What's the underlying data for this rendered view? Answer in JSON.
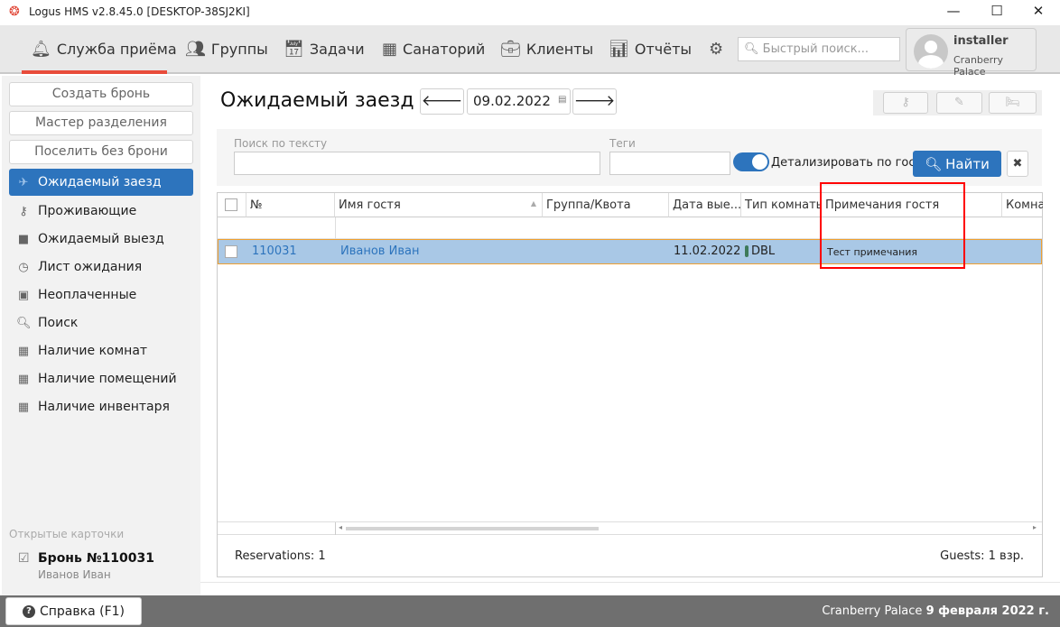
{
  "window": {
    "title": "Logus HMS v2.8.45.0 [DESKTOP-38SJ2KI]",
    "minimize": "—",
    "maximize": "☐",
    "close": "✕"
  },
  "nav": {
    "items": [
      {
        "label": "Служба приёма",
        "icon": "bell-icon"
      },
      {
        "label": "Группы",
        "icon": "users-icon"
      },
      {
        "label": "Задачи",
        "icon": "calendar-check-icon"
      },
      {
        "label": "Санаторий",
        "icon": "building-icon"
      },
      {
        "label": "Клиенты",
        "icon": "briefcase-icon"
      },
      {
        "label": "Отчёты",
        "icon": "bar-chart-icon"
      }
    ],
    "quick_search_placeholder": "Быстрый поиск...",
    "user": {
      "name": "installer",
      "hotel": "Cranberry Palace"
    }
  },
  "sidebar": {
    "buttons": [
      "Создать бронь",
      "Мастер разделения",
      "Поселить без брони"
    ],
    "items": [
      {
        "label": "Ожидаемый заезд",
        "icon": "plane-icon",
        "active": true
      },
      {
        "label": "Проживающие",
        "icon": "key-icon"
      },
      {
        "label": "Ожидаемый выезд",
        "icon": "suitcase-icon"
      },
      {
        "label": "Лист ожидания",
        "icon": "clock-icon"
      },
      {
        "label": "Неоплаченные",
        "icon": "money-icon"
      },
      {
        "label": "Поиск",
        "icon": "search-icon"
      },
      {
        "label": "Наличие комнат",
        "icon": "grid-icon"
      },
      {
        "label": "Наличие помещений",
        "icon": "grid-icon"
      },
      {
        "label": "Наличие инвентаря",
        "icon": "grid-icon"
      }
    ],
    "open_cards_label": "Открытые карточки",
    "open_card": {
      "title": "Бронь №110031",
      "subtitle": "Иванов Иван"
    }
  },
  "main": {
    "title": "Ожидаемый заезд",
    "date": "09.02.2022",
    "filter": {
      "text_label": "Поиск по тексту",
      "text_value": "",
      "tags_label": "Теги",
      "tags_value": "",
      "detail_toggle_label": "Детализировать по гостя",
      "detail_toggle_on": true,
      "find_label": "Найти"
    },
    "grid": {
      "columns": [
        "№",
        "Имя гостя",
        "Группа/Квота",
        "Дата вые...",
        "Тип комнаты",
        "Примечания гостя",
        "Комна"
      ],
      "rows": [
        {
          "number": "110031",
          "guest": "Иванов Иван",
          "group": "",
          "departure": "11.02.2022",
          "room_type": "DBL",
          "notes": "Тест примечания",
          "room": "",
          "selected": true
        }
      ],
      "footer_reservations": "Reservations: 1",
      "footer_guests": "Guests: 1 взр."
    }
  },
  "statusbar": {
    "help_label": "Справка (F1)",
    "hotel": "Cranberry Palace",
    "date": "9 февраля 2022 г."
  },
  "colors": {
    "accent": "#2d74bd",
    "nav_underline": "#e84b3a",
    "selected_row": "#a9c8e6",
    "highlight_box": "#ff0000"
  }
}
